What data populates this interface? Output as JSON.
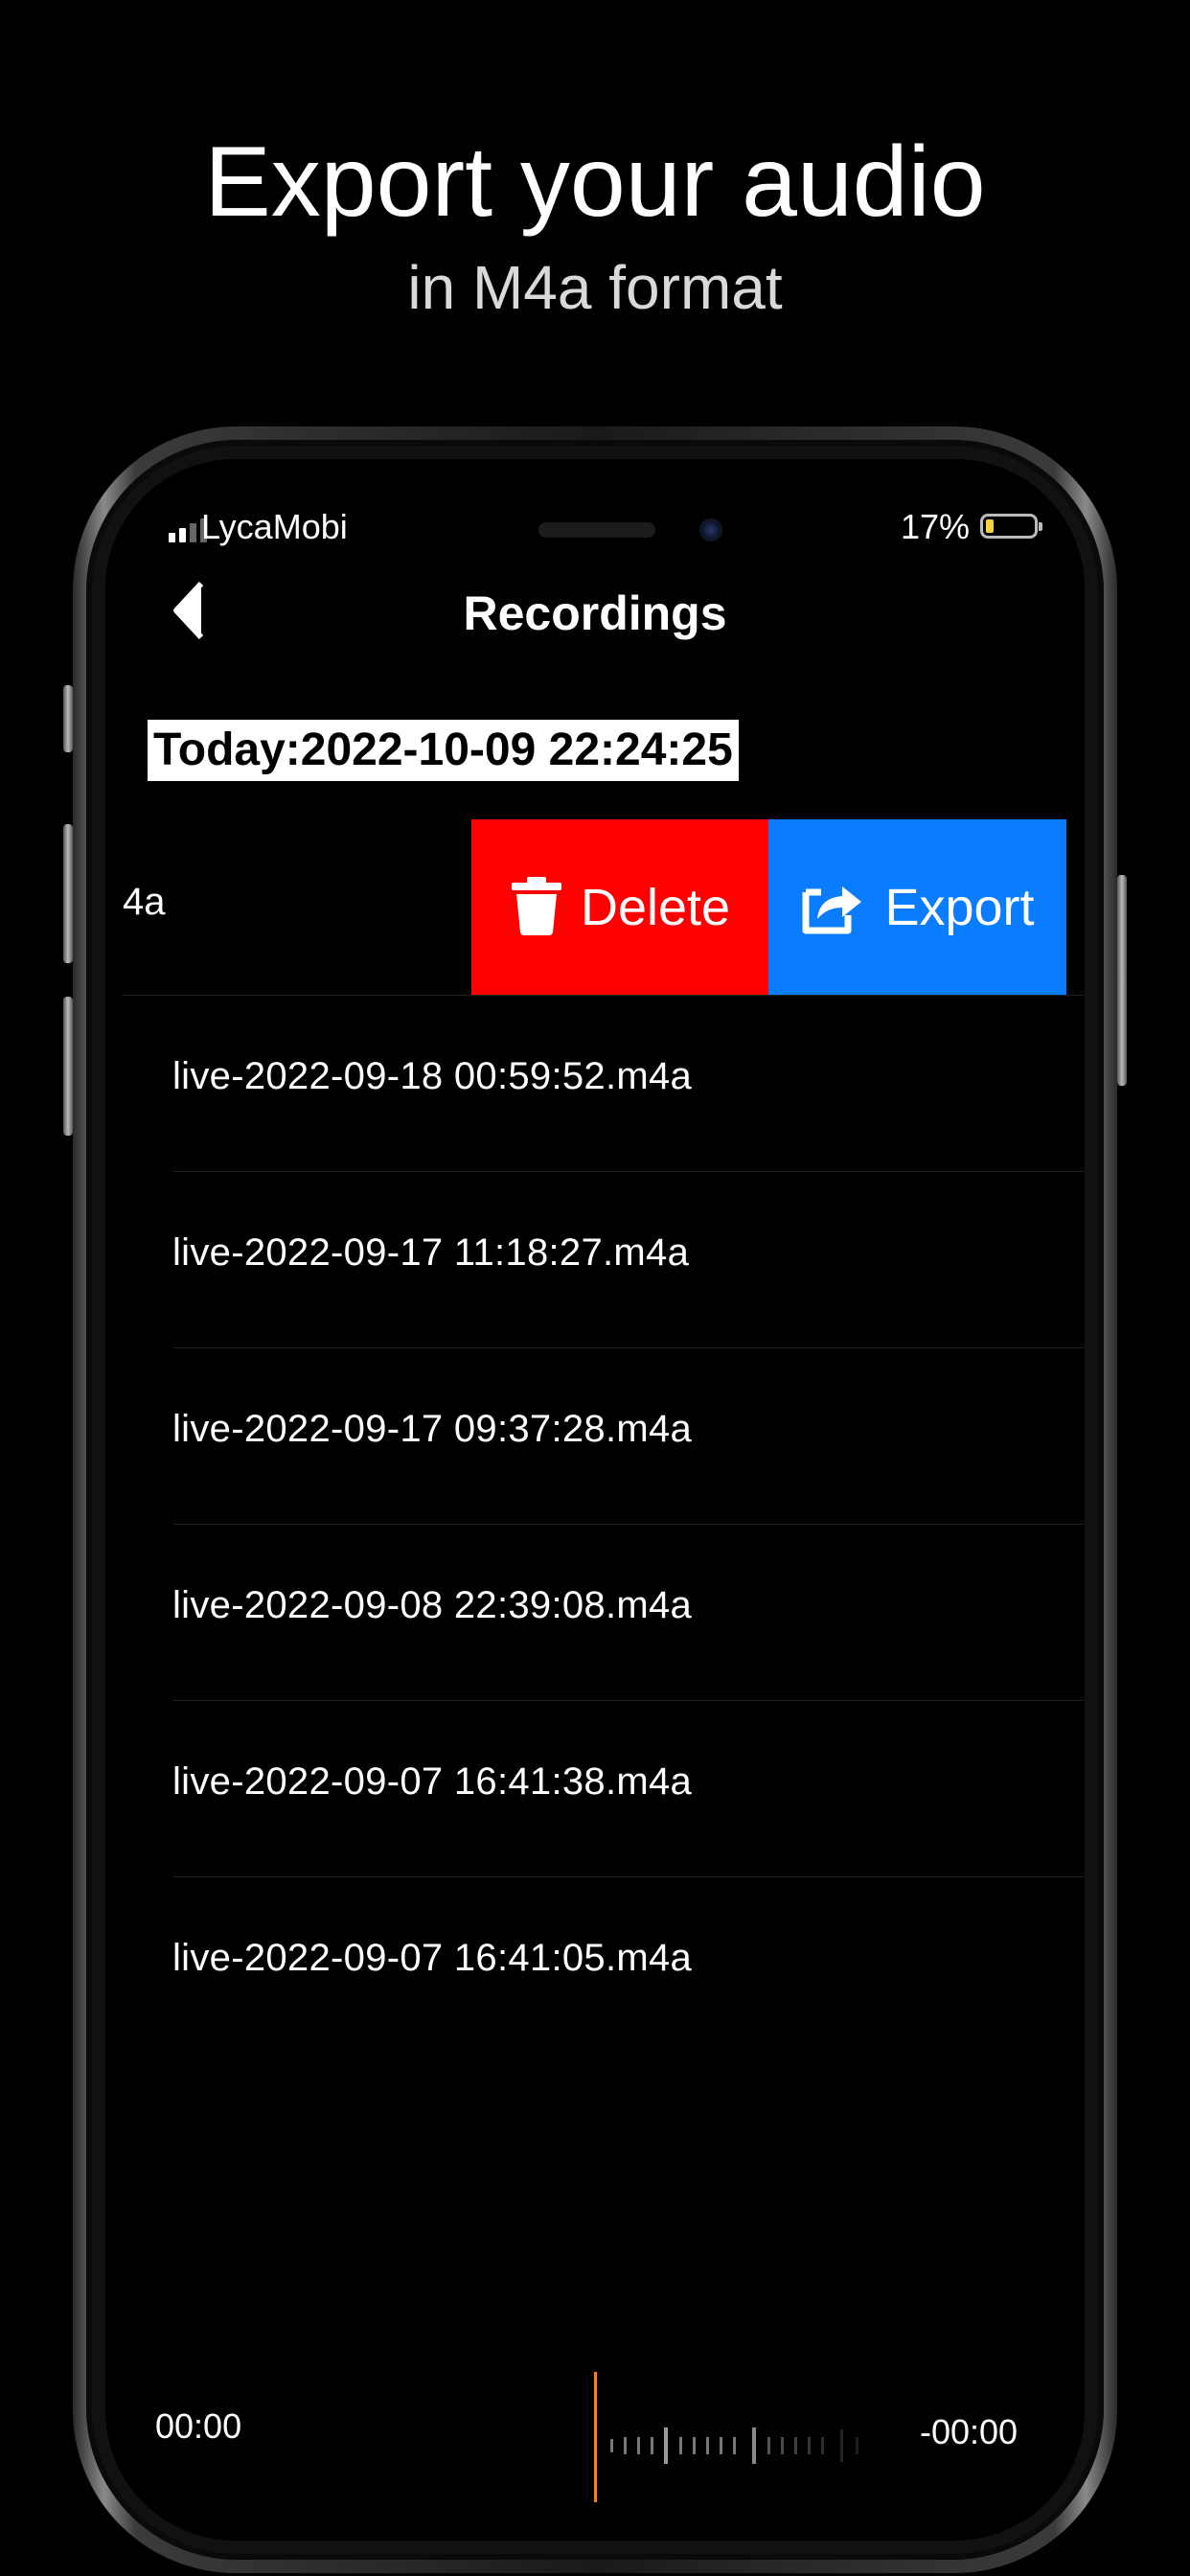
{
  "promo": {
    "headline": "Export your audio",
    "subheadline": "in M4a format"
  },
  "status_bar": {
    "carrier": "LycaMobi",
    "battery_percent": "17%",
    "battery_level": 0.17,
    "battery_color": "#f6d33c"
  },
  "nav": {
    "title": "Recordings",
    "back_icon": "chevron-left-icon"
  },
  "section_header": "Today:2022-10-09 22:24:25",
  "swiped_row": {
    "visible_text": "4a",
    "actions": {
      "delete_label": "Delete",
      "delete_icon": "trash-icon",
      "delete_color": "#ff0000",
      "export_label": "Export",
      "export_icon": "share-icon",
      "export_color": "#0a7cff"
    }
  },
  "recordings": [
    "live-2022-09-18 00:59:52.m4a",
    "live-2022-09-17 11:18:27.m4a",
    "live-2022-09-17 09:37:28.m4a",
    "live-2022-09-08 22:39:08.m4a",
    "live-2022-09-07 16:41:38.m4a",
    "live-2022-09-07 16:41:05.m4a"
  ],
  "player": {
    "elapsed": "00:00",
    "remaining": "-00:00",
    "playhead_color": "#ff7a1a"
  }
}
